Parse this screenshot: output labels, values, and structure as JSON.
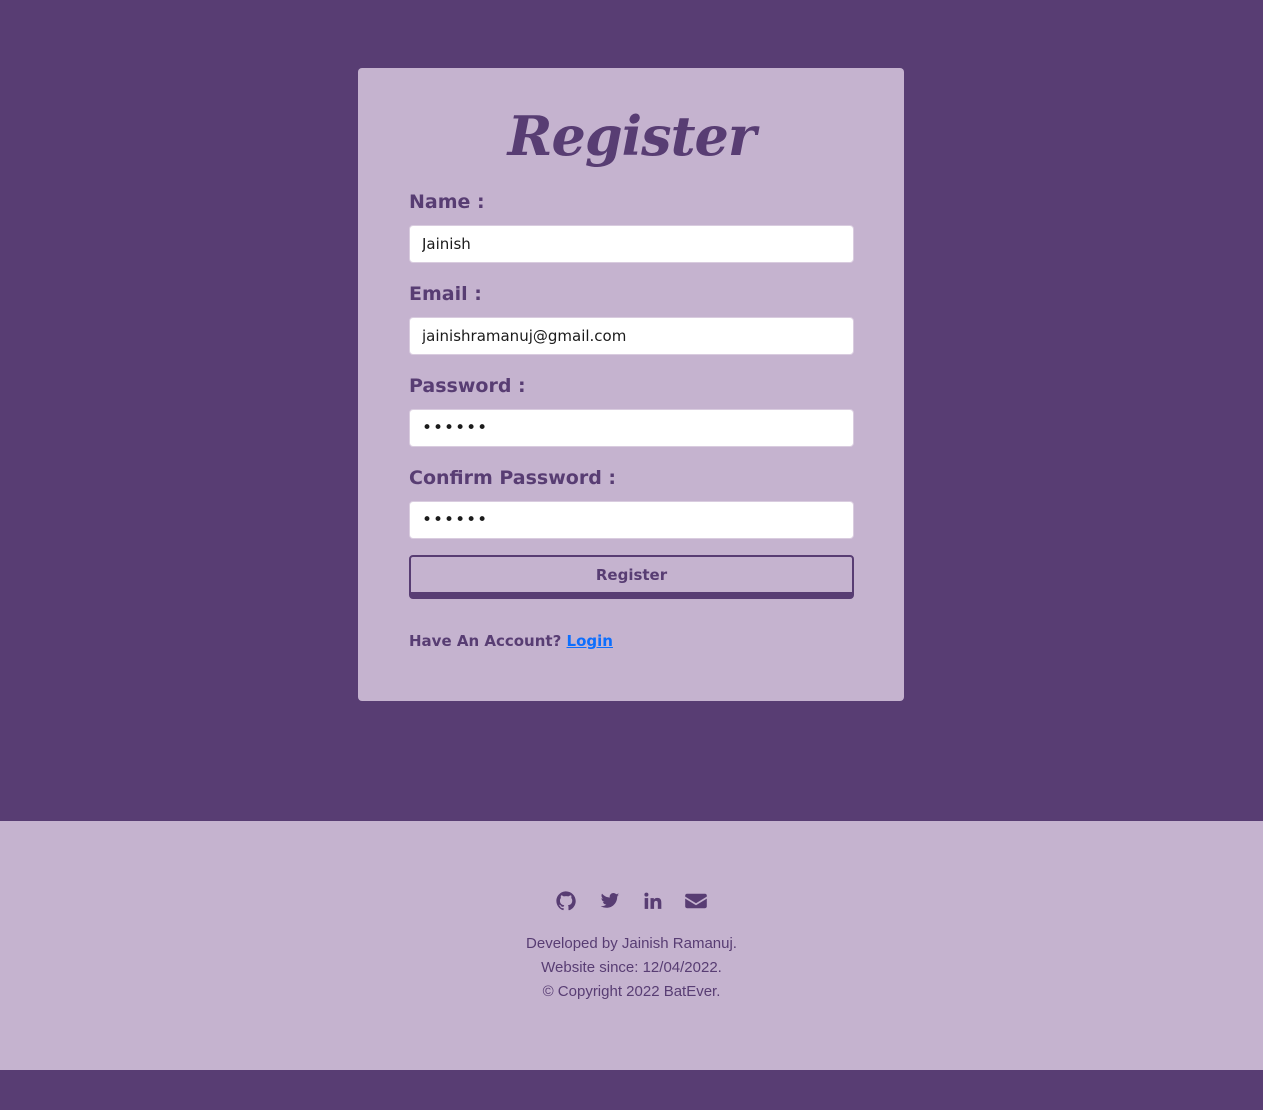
{
  "form": {
    "title": "Register",
    "name_label": "Name :",
    "name_value": "Jainish",
    "email_label": "Email :",
    "email_value": "jainishramanuj@gmail.com",
    "password_label": "Password :",
    "password_value": "••••••",
    "confirm_label": "Confirm Password :",
    "confirm_value": "••••••",
    "submit_label": "Register",
    "have_account_text": "Have An Account?",
    "login_link": "Login"
  },
  "footer": {
    "social_icons": [
      "github-icon",
      "twitter-icon",
      "linkedin-icon",
      "envelope-icon"
    ],
    "developed_by": "Developed by Jainish Ramanuj.",
    "since": "Website since: 12/04/2022.",
    "copyright": "© Copyright 2022 BatEver."
  },
  "colors": {
    "background": "#583d73",
    "card": "#c5b3cf",
    "accent": "#583d73",
    "link": "#0d6efd"
  }
}
